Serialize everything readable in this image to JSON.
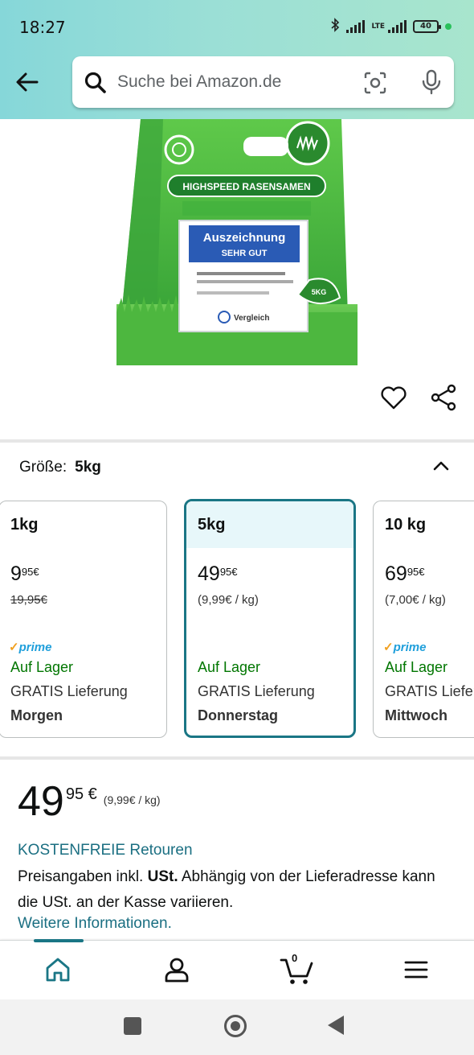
{
  "status_bar": {
    "time": "18:27",
    "network": "LTE",
    "battery": "40"
  },
  "search": {
    "placeholder": "Suche bei Amazon.de"
  },
  "product_image": {
    "title_label": "HIGHSPEED RASENSAMEN",
    "award_line1": "Auszeichnung",
    "award_line2": "SEHR GUT",
    "badge": "5KG",
    "vergleich": "Vergleich"
  },
  "size_selector": {
    "label": "Größe:",
    "selected": "5kg",
    "options": [
      {
        "name": "1kg",
        "price_main": "9",
        "price_frac": "95",
        "currency": "€",
        "sub": "19,95€",
        "prime": "prime",
        "stock": "Auf Lager",
        "delivery": "GRATIS Lieferung",
        "date": "Morgen"
      },
      {
        "name": "5kg",
        "price_main": "49",
        "price_frac": "95",
        "currency": "€",
        "sub": "(9,99€ / kg)",
        "stock": "Auf Lager",
        "delivery": "GRATIS Lieferung",
        "date": "Donnerstag"
      },
      {
        "name": "10 kg",
        "price_main": "69",
        "price_frac": "95",
        "currency": "€",
        "sub": "(7,00€ / kg)",
        "prime": "prime",
        "stock": "Auf Lager",
        "delivery": "GRATIS Lieferung",
        "date": "Mittwoch"
      }
    ]
  },
  "price": {
    "main": "49",
    "frac": "95",
    "currency": "€",
    "unit_price": "(9,99€ / kg)"
  },
  "returns_label": "KOSTENFREIE Retouren",
  "vat_note": {
    "before": "Preisangaben inkl. ",
    "bold": "USt.",
    "after": " Abhängig von der Lieferadresse kann die USt. an der Kasse variieren."
  },
  "more_info_link": "Weitere Informationen.",
  "bottom_nav": {
    "cart_count": "0"
  },
  "colors": {
    "accent": "#1a7685",
    "in_stock": "#007600",
    "link": "#1b6f82",
    "header_gradient_start": "#86d7d9",
    "header_gradient_end": "#a8e5cd"
  }
}
